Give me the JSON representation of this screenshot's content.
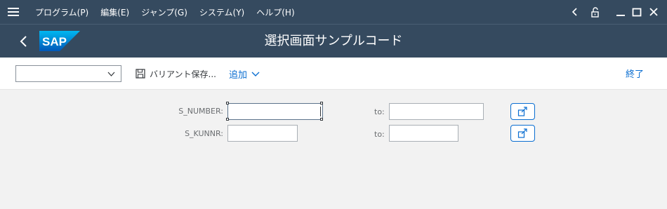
{
  "menu": {
    "items": [
      {
        "label": "プログラム(P)"
      },
      {
        "label": "編集(E)"
      },
      {
        "label": "ジャンプ(G)"
      },
      {
        "label": "システム(Y)"
      },
      {
        "label": "ヘルプ(H)"
      }
    ]
  },
  "header": {
    "title": "選択画面サンプルコード",
    "logo_text": "SAP"
  },
  "toolbar": {
    "variant_value": "",
    "save_variant_label": "バリアント保存...",
    "add_label": "追加",
    "exit_label": "終了"
  },
  "selection": {
    "rows": [
      {
        "label": "S_NUMBER:",
        "low": "",
        "to_label": "to:",
        "high": ""
      },
      {
        "label": "S_KUNNR:",
        "low": "",
        "to_label": "to:",
        "high": ""
      }
    ]
  },
  "colors": {
    "shell": "#354a5f",
    "accent": "#0a6ed1",
    "content_bg": "#f2f2f2"
  },
  "icons": {
    "menu": "hamburger-icon",
    "back": "chevron-left-icon",
    "save": "floppy-disk-icon",
    "add_dropdown": "chevron-down-icon",
    "multiple_selection": "multiple-selection-icon",
    "lock": "unlock-icon",
    "minimize": "minimize-icon",
    "maximize": "maximize-icon",
    "close": "close-icon"
  }
}
